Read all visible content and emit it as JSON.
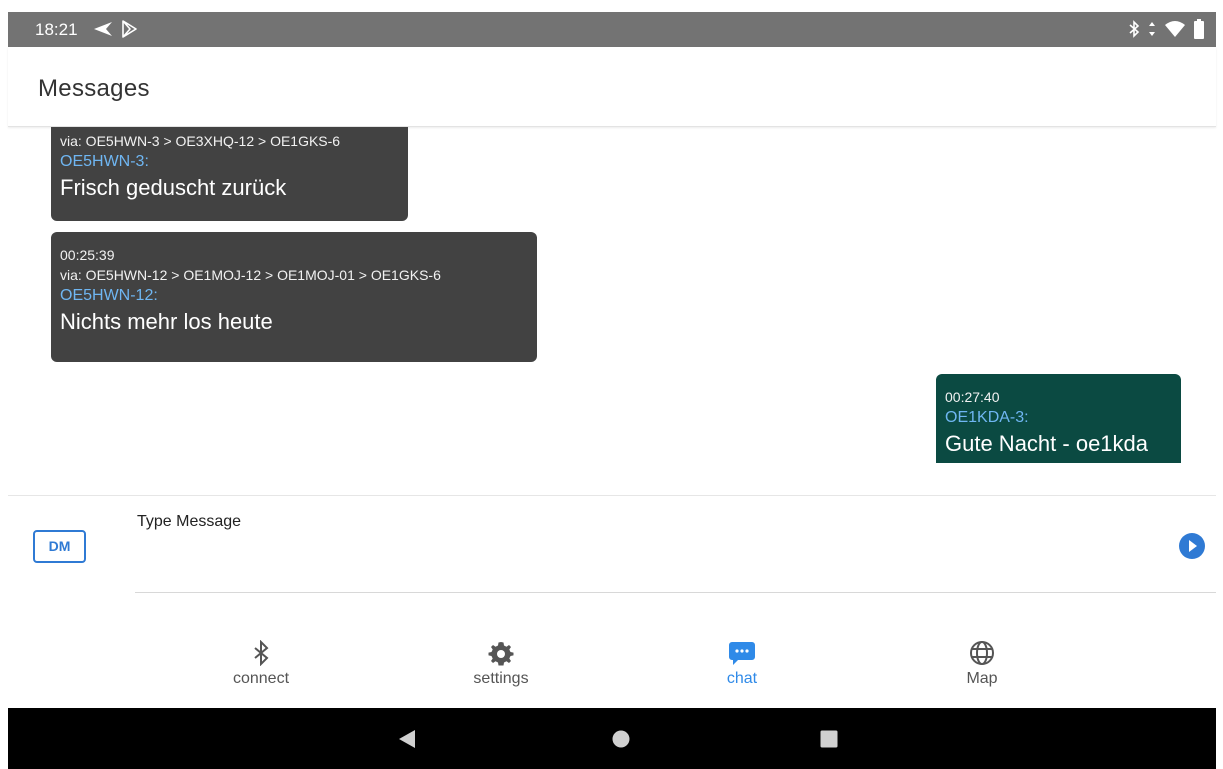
{
  "status_bar": {
    "time": "18:21"
  },
  "app_bar": {
    "title": "Messages"
  },
  "messages": [
    {
      "direction": "in",
      "via": "via: OE5HWN-3 > OE3XHQ-12 > OE1GKS-6",
      "sender": "OE5HWN-3:",
      "text": "Frisch geduscht zurück"
    },
    {
      "direction": "in",
      "time": "00:25:39",
      "via": "via: OE5HWN-12 > OE1MOJ-12 > OE1MOJ-01 > OE1GKS-6",
      "sender": "OE5HWN-12:",
      "text": "Nichts mehr los heute"
    },
    {
      "direction": "out",
      "time": "00:27:40",
      "sender": "OE1KDA-3:",
      "text": "Gute Nacht - oe1kda"
    }
  ],
  "composer": {
    "dm_label": "DM",
    "placeholder": "Type Message"
  },
  "nav": [
    {
      "label": "connect",
      "icon": "bluetooth-icon",
      "active": false
    },
    {
      "label": "settings",
      "icon": "gear-icon",
      "active": false
    },
    {
      "label": "chat",
      "icon": "chat-icon",
      "active": true
    },
    {
      "label": "Map",
      "icon": "globe-icon",
      "active": false
    }
  ],
  "colors": {
    "incoming_bubble": "#424242",
    "outgoing_bubble": "#0b4a42",
    "sender_text": "#6fb6f2",
    "accent": "#2f7ad4",
    "active_nav": "#2f8ae8"
  }
}
